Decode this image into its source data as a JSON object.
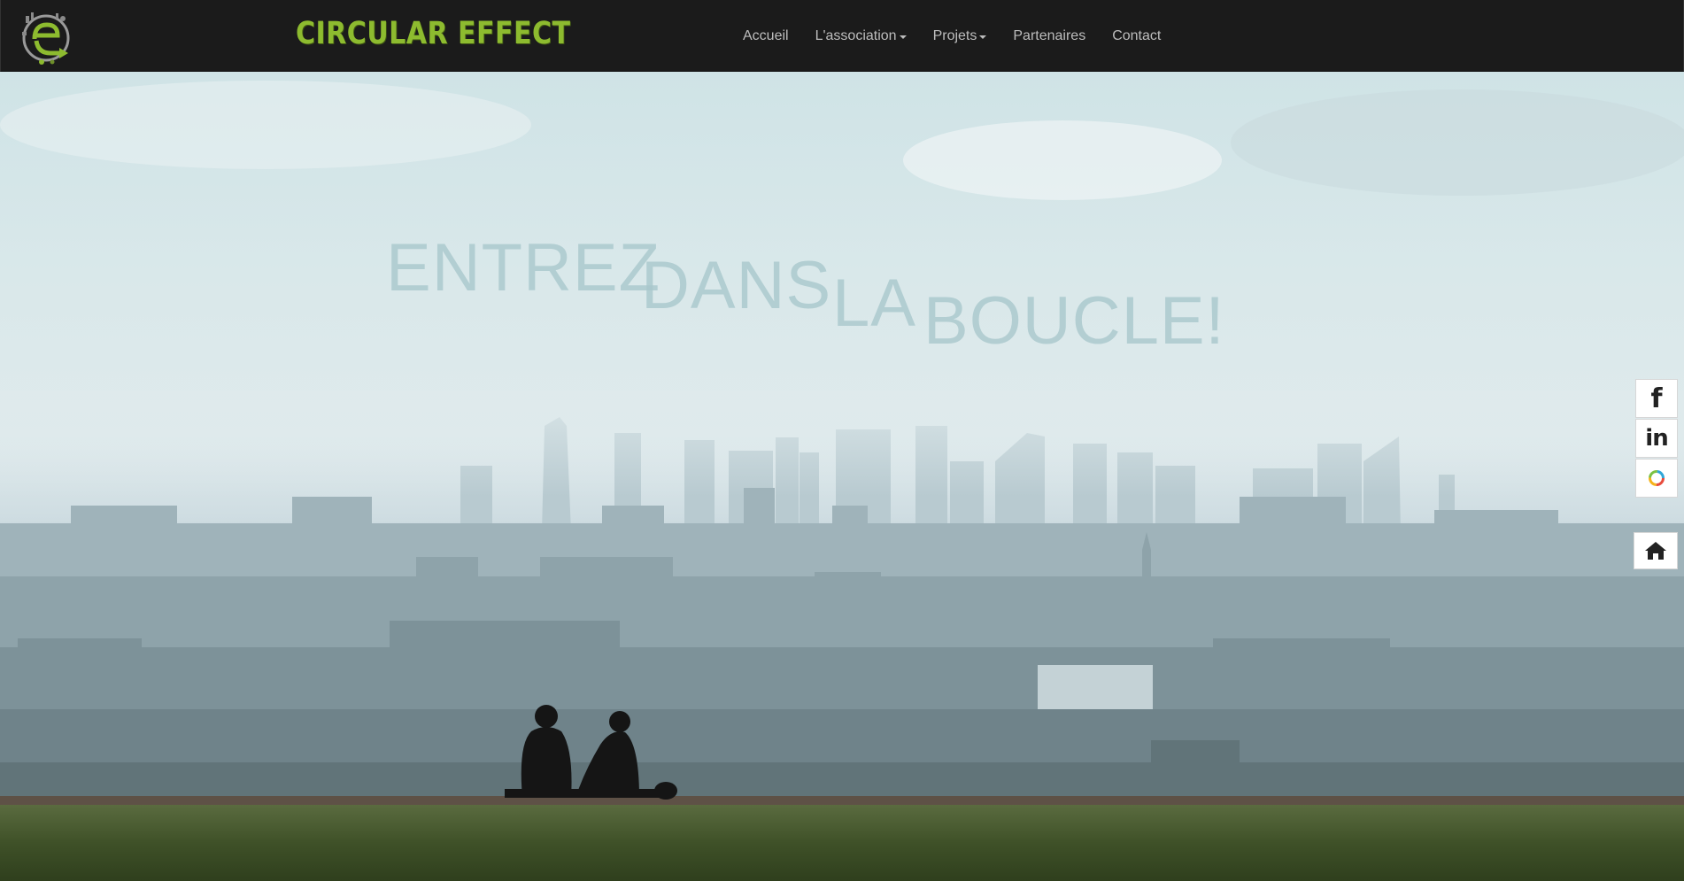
{
  "navbar": {
    "brand": "CIRCULAR EFFECT",
    "logo_letter": "e",
    "brand_color": "#8dbb2f",
    "items": [
      {
        "label": "Accueil",
        "dropdown": false
      },
      {
        "label": "L'association",
        "dropdown": true
      },
      {
        "label": "Projets",
        "dropdown": true
      },
      {
        "label": "Partenaires",
        "dropdown": false
      },
      {
        "label": "Contact",
        "dropdown": false
      }
    ]
  },
  "hero": {
    "headline": [
      "ENTREZ",
      "DANS",
      "LA",
      "BOUCLE!"
    ]
  },
  "social": {
    "facebook_icon": "f",
    "linkedin_icon": "in",
    "icons": [
      "facebook-icon",
      "linkedin-icon",
      "circular-icon",
      "home-icon"
    ]
  }
}
